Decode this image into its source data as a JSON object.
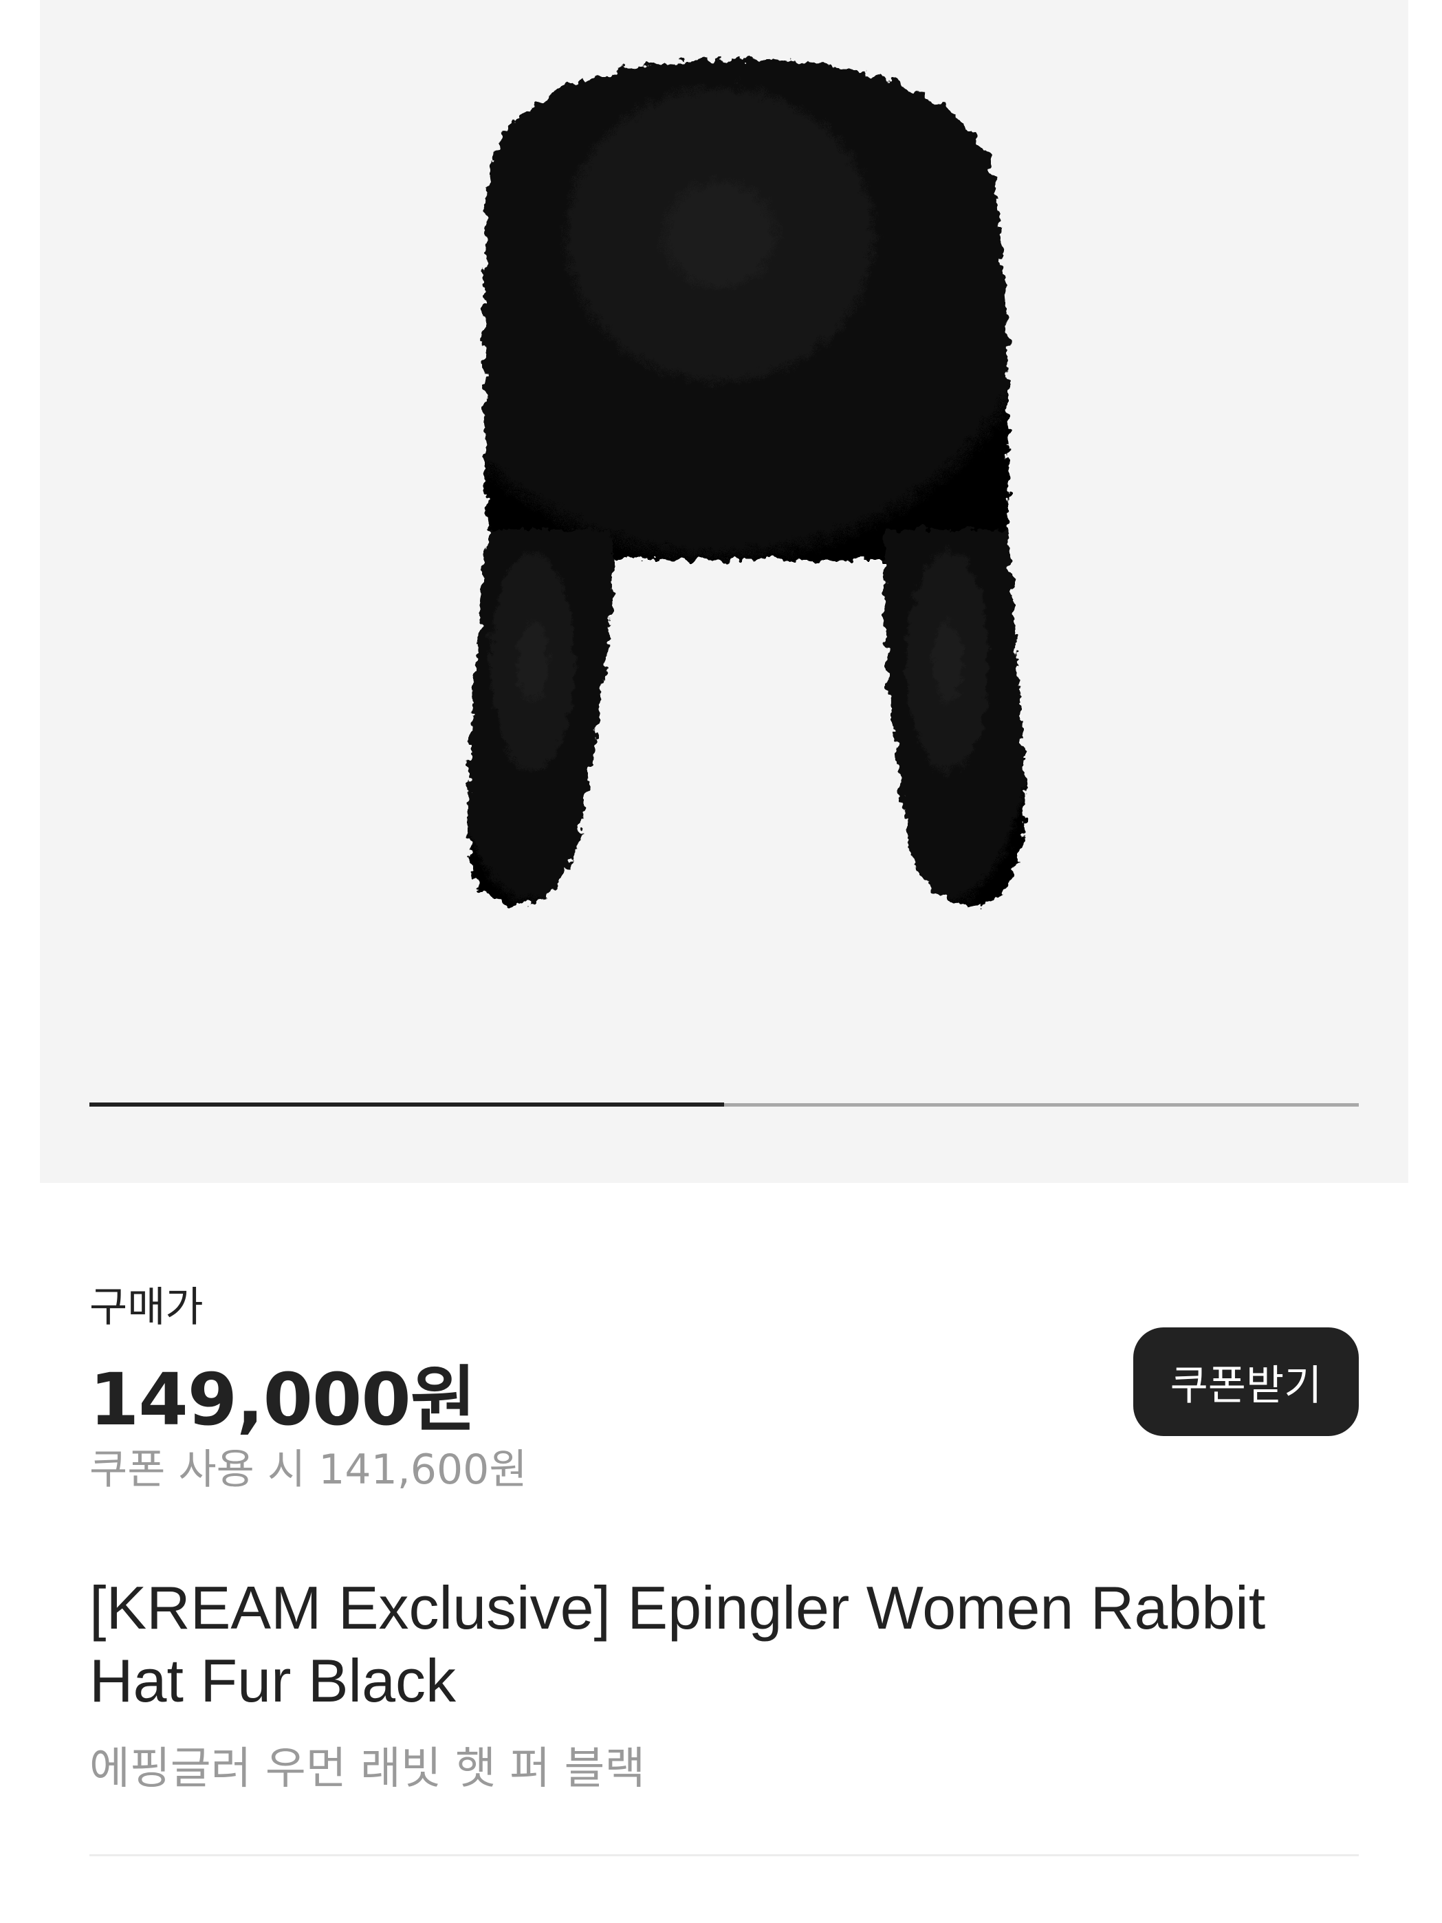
{
  "gallery": {
    "image_alt": "black fur trapper hat with ear flaps",
    "progress": 0.5,
    "colors": {
      "background": "#f4f4f4",
      "track": "#a8a8a8",
      "fill": "#222222"
    }
  },
  "pricing": {
    "label": "구매가",
    "price": "149,000원",
    "coupon_price": "쿠폰 사용 시 141,600원",
    "coupon_button_label": "쿠폰받기"
  },
  "product": {
    "title": "[KREAM Exclusive] Epingler Women Rabbit Hat Fur Black",
    "subtitle": "에핑글러 우먼 래빗 햇 퍼 블랙"
  },
  "colors": {
    "text_primary": "#222222",
    "text_secondary": "#9a9a9a",
    "button_bg": "#222222",
    "button_text": "#ffffff"
  }
}
